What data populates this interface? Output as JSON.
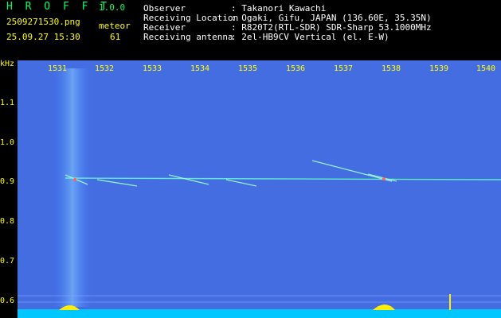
{
  "app": {
    "name": "H R O F F T",
    "version": "1.0.0",
    "filename": "2509271530.png",
    "datetime": "25.09.27 15:30",
    "meteor_label": "meteor",
    "meteor_count": "61"
  },
  "info": {
    "rows": [
      {
        "label": "Observer",
        "value": ": Takanori Kawachi"
      },
      {
        "label": "Receiving Location",
        "value": ": Ogaki, Gifu, JAPAN (136.60E, 35.35N)"
      },
      {
        "label": "Receiver",
        "value": ": R820T2(RTL-SDR) SDR-Sharp 53.1000MHz"
      },
      {
        "label": "Receiving antenna",
        "value": ": 2el-HB9CV Vertical (el. E-W)"
      }
    ]
  },
  "axes": {
    "y_unit": "kHz",
    "y_ticks": [
      "1.1",
      "1.0",
      "0.9",
      "0.8",
      "0.7",
      "0.6"
    ],
    "x_ticks": [
      "1531",
      "1532",
      "1533",
      "1534",
      "1535",
      "1536",
      "1537",
      "1538",
      "1539",
      "1540"
    ]
  },
  "colors": {
    "background": "#00003a",
    "noise": "#1f4dcc",
    "carrier": "#66ffcc",
    "label_yellow": "#ffff00",
    "label_green": "#00ff66",
    "baseline": "#00c8ff",
    "peak": "#ffee00"
  }
}
